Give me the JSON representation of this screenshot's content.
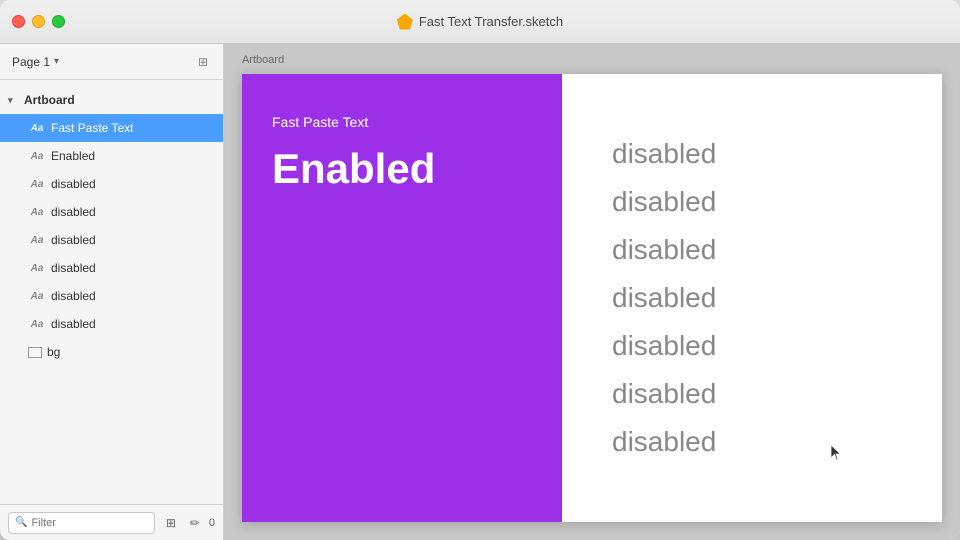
{
  "window": {
    "title": "Fast Text Transfer.sketch"
  },
  "titlebar": {
    "title": "Fast Text Transfer.sketch",
    "traffic_lights": {
      "close": "close",
      "minimize": "minimize",
      "maximize": "maximize"
    }
  },
  "sidebar": {
    "page_label": "Page 1",
    "artboard_label": "Artboard",
    "layers": [
      {
        "type": "text",
        "label": "Fast Paste Text",
        "selected": true
      },
      {
        "type": "text",
        "label": "Enabled",
        "selected": false
      },
      {
        "type": "text",
        "label": "disabled",
        "selected": false
      },
      {
        "type": "text",
        "label": "disabled",
        "selected": false
      },
      {
        "type": "text",
        "label": "disabled",
        "selected": false
      },
      {
        "type": "text",
        "label": "disabled",
        "selected": false
      },
      {
        "type": "text",
        "label": "disabled",
        "selected": false
      },
      {
        "type": "text",
        "label": "disabled",
        "selected": false
      },
      {
        "type": "rect",
        "label": "bg",
        "selected": false
      }
    ],
    "filter_placeholder": "Filter"
  },
  "canvas": {
    "artboard_label": "Artboard",
    "left_panel": {
      "small_title": "Fast Paste Text",
      "big_title": "Enabled",
      "background_color": "#9b30e8"
    },
    "right_panel": {
      "items": [
        "disabled",
        "disabled",
        "disabled",
        "disabled",
        "disabled",
        "disabled",
        "disabled"
      ]
    }
  },
  "footer": {
    "filter_label": "Filter",
    "badge": "0"
  }
}
